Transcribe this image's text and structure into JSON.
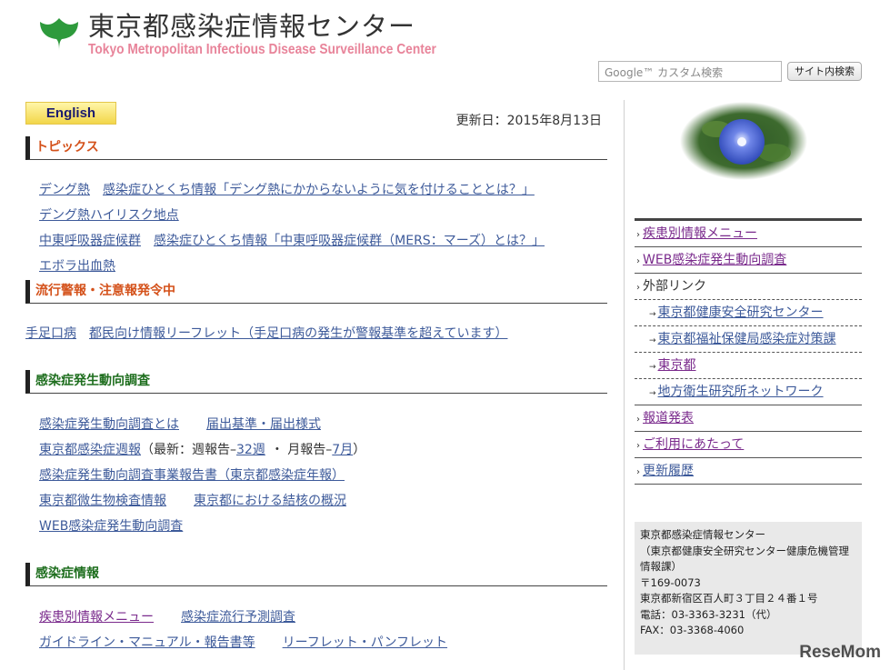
{
  "header": {
    "title_ja": "東京都感染症情報センター",
    "title_en": "Tokyo Metropolitan Infectious Disease Surveillance Center",
    "search_placeholder": "Google™ カスタム検索",
    "search_button": "サイト内検索",
    "logo_color": "#2e9a3c"
  },
  "main": {
    "english_button": "English",
    "update_date": "更新日：2015年8月13日",
    "sections": {
      "topics": {
        "heading": "トピックス",
        "rows": [
          [
            "デング熱",
            "感染症ひとくち情報「デング熱にかからないように気を付けることとは？」"
          ],
          [
            "デング熱ハイリスク地点"
          ],
          [
            "中東呼吸器症候群",
            "感染症ひとくち情報「中東呼吸器症候群（MERS：マーズ）とは？」"
          ],
          [
            "エボラ出血熱"
          ]
        ]
      },
      "alerts": {
        "heading": "流行警報・注意報発令中",
        "row": [
          "手足口病",
          "都民向け情報リーフレット（手足口病の発生が警報基準を超えています）"
        ]
      },
      "survey": {
        "heading": "感染症発生動向調査",
        "row1": [
          "感染症発生動向調査とは",
          "届出基準・届出様式"
        ],
        "row2_link": "東京都感染症週報",
        "row2_text_a": "（最新：週報告–",
        "row2_week": "32週",
        "row2_text_b": "・ 月報告–",
        "row2_month": "7月",
        "row2_text_c": "）",
        "row3": "感染症発生動向調査事業報告書（東京都感染症年報）",
        "row4": [
          "東京都微生物検査情報",
          "東京都における結核の概況"
        ],
        "row5": "WEB感染症発生動向調査"
      },
      "info": {
        "heading": "感染症情報",
        "row1": [
          "疾患別情報メニュー",
          "感染症流行予測調査"
        ],
        "row2": [
          "ガイドライン・マニュアル・報告書等",
          "リーフレット・パンフレット"
        ]
      }
    }
  },
  "sidebar": {
    "menu": {
      "disease_menu": "疾患別情報メニュー",
      "web_survey": "WEB感染症発生動向調査",
      "external_links": "外部リンク",
      "ext_1": "東京都健康安全研究センター",
      "ext_2": "東京都福祉保健局感染症対策課",
      "ext_3": "東京都",
      "ext_4": "地方衛生研究所ネットワーク",
      "press": "報道発表",
      "usage": "ご利用にあたって",
      "history": "更新履歴"
    },
    "contact": {
      "name": "東京都感染症情報センター",
      "org1": "（東京都健康安全研究センター健康危機管理",
      "org2": "情報課）",
      "zip": "〒169-0073",
      "address": "東京都新宿区百人町３丁目２４番１号",
      "tel": "電話：03-3363-3231（代）",
      "fax": "FAX：03-3368-4060"
    }
  },
  "watermark": "ReseMom"
}
